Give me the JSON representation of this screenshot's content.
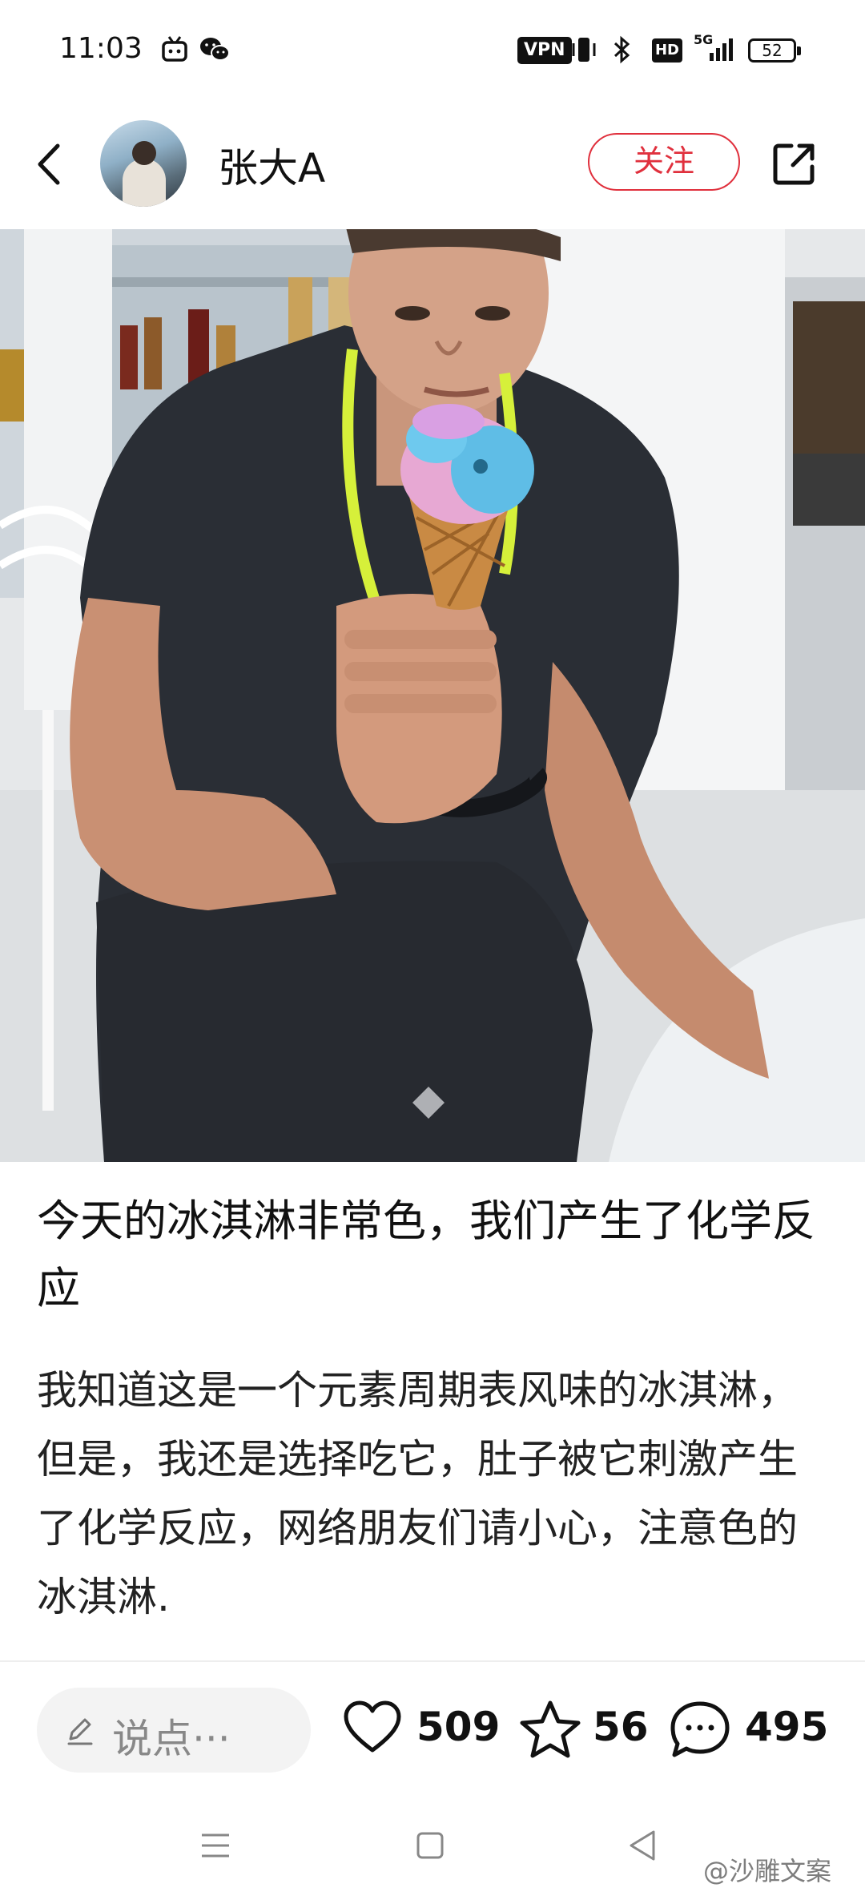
{
  "status_bar": {
    "time": "11:03",
    "vpn_label": "VPN",
    "hd_label": "HD",
    "network_label": "5G",
    "battery_level": "52"
  },
  "header": {
    "username": "张大A",
    "follow_label": "关注"
  },
  "post": {
    "title": "今天的冰淇淋非常色，我们产生了化学反应",
    "body": "我知道这是一个元素周期表风味的冰淇淋，但是，我还是选择吃它，肚子被它刺激产生了化学反应，网络朋友们请小心，注意色的冰淇淋."
  },
  "actions": {
    "comment_placeholder": "说点···",
    "likes": "509",
    "favorites": "56",
    "comments": "495"
  },
  "watermark": "@沙雕文案",
  "colors": {
    "accent": "#e0303d",
    "background": "#ffffff"
  }
}
